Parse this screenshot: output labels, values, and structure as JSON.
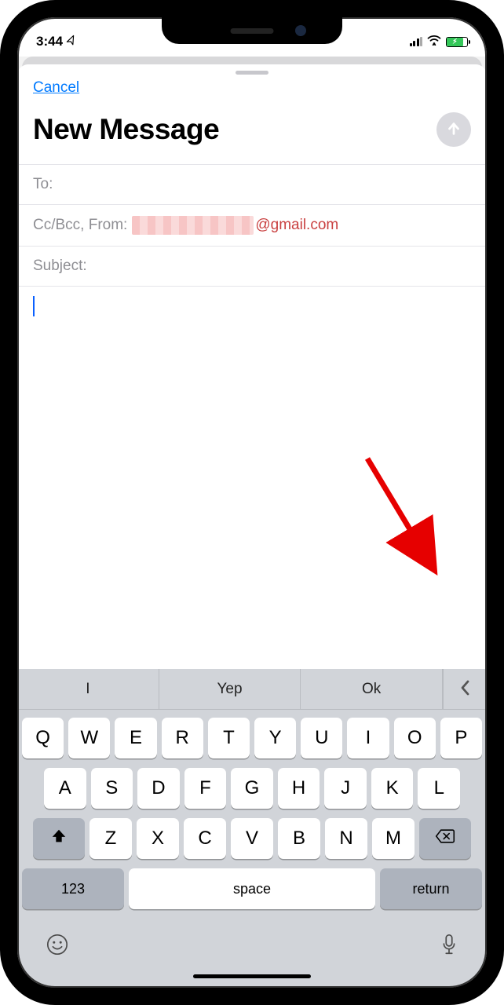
{
  "status": {
    "time": "3:44",
    "location_glyph": "➤"
  },
  "nav": {
    "cancel": "Cancel"
  },
  "compose": {
    "title": "New Message",
    "to_label": "To:",
    "ccbcc_from_label": "Cc/Bcc, From:",
    "from_domain": "@gmail.com",
    "subject_label": "Subject:"
  },
  "keyboard": {
    "predictions": [
      "I",
      "Yep",
      "Ok"
    ],
    "row1": [
      "Q",
      "W",
      "E",
      "R",
      "T",
      "Y",
      "U",
      "I",
      "O",
      "P"
    ],
    "row2": [
      "A",
      "S",
      "D",
      "F",
      "G",
      "H",
      "J",
      "K",
      "L"
    ],
    "row3": [
      "Z",
      "X",
      "C",
      "V",
      "B",
      "N",
      "M"
    ],
    "numbers_key": "123",
    "space_key": "space",
    "return_key": "return"
  }
}
